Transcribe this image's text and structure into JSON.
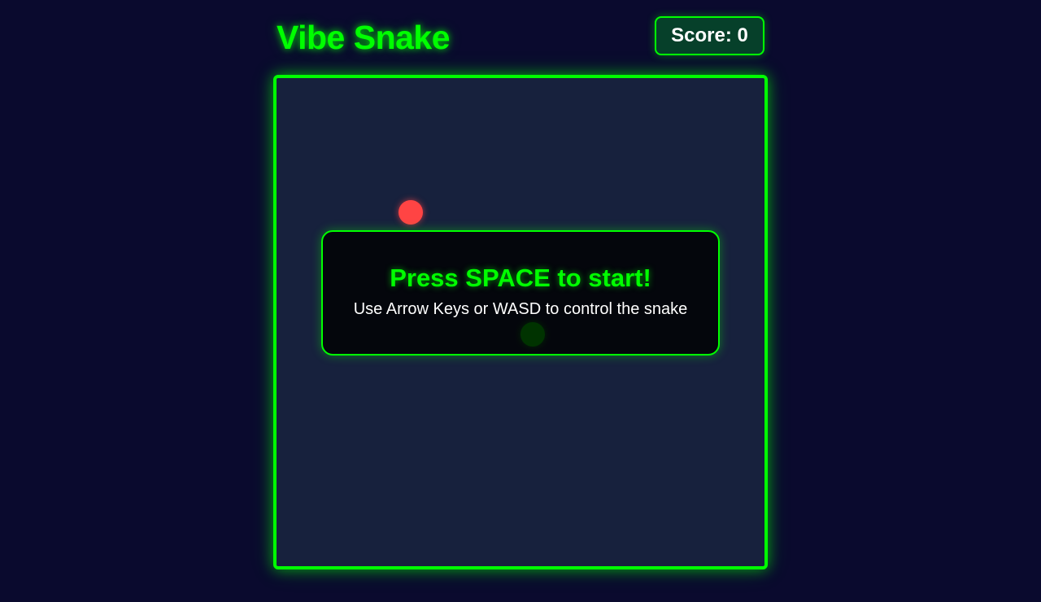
{
  "header": {
    "title": "Vibe Snake",
    "score_label": "Score:",
    "score_value": 0
  },
  "game": {
    "status": "idle",
    "food": {
      "shape": "circle",
      "color": "#ff4444"
    },
    "snake": {
      "head_color": "#00ff00",
      "segments": 1
    },
    "overlay": {
      "title": "Press SPACE to start!",
      "hint": "Use Arrow Keys or WASD to control the snake"
    }
  },
  "colors": {
    "background": "#0a0a2e",
    "accent": "#00ff00",
    "board": "#17213d",
    "food": "#ff4444"
  }
}
